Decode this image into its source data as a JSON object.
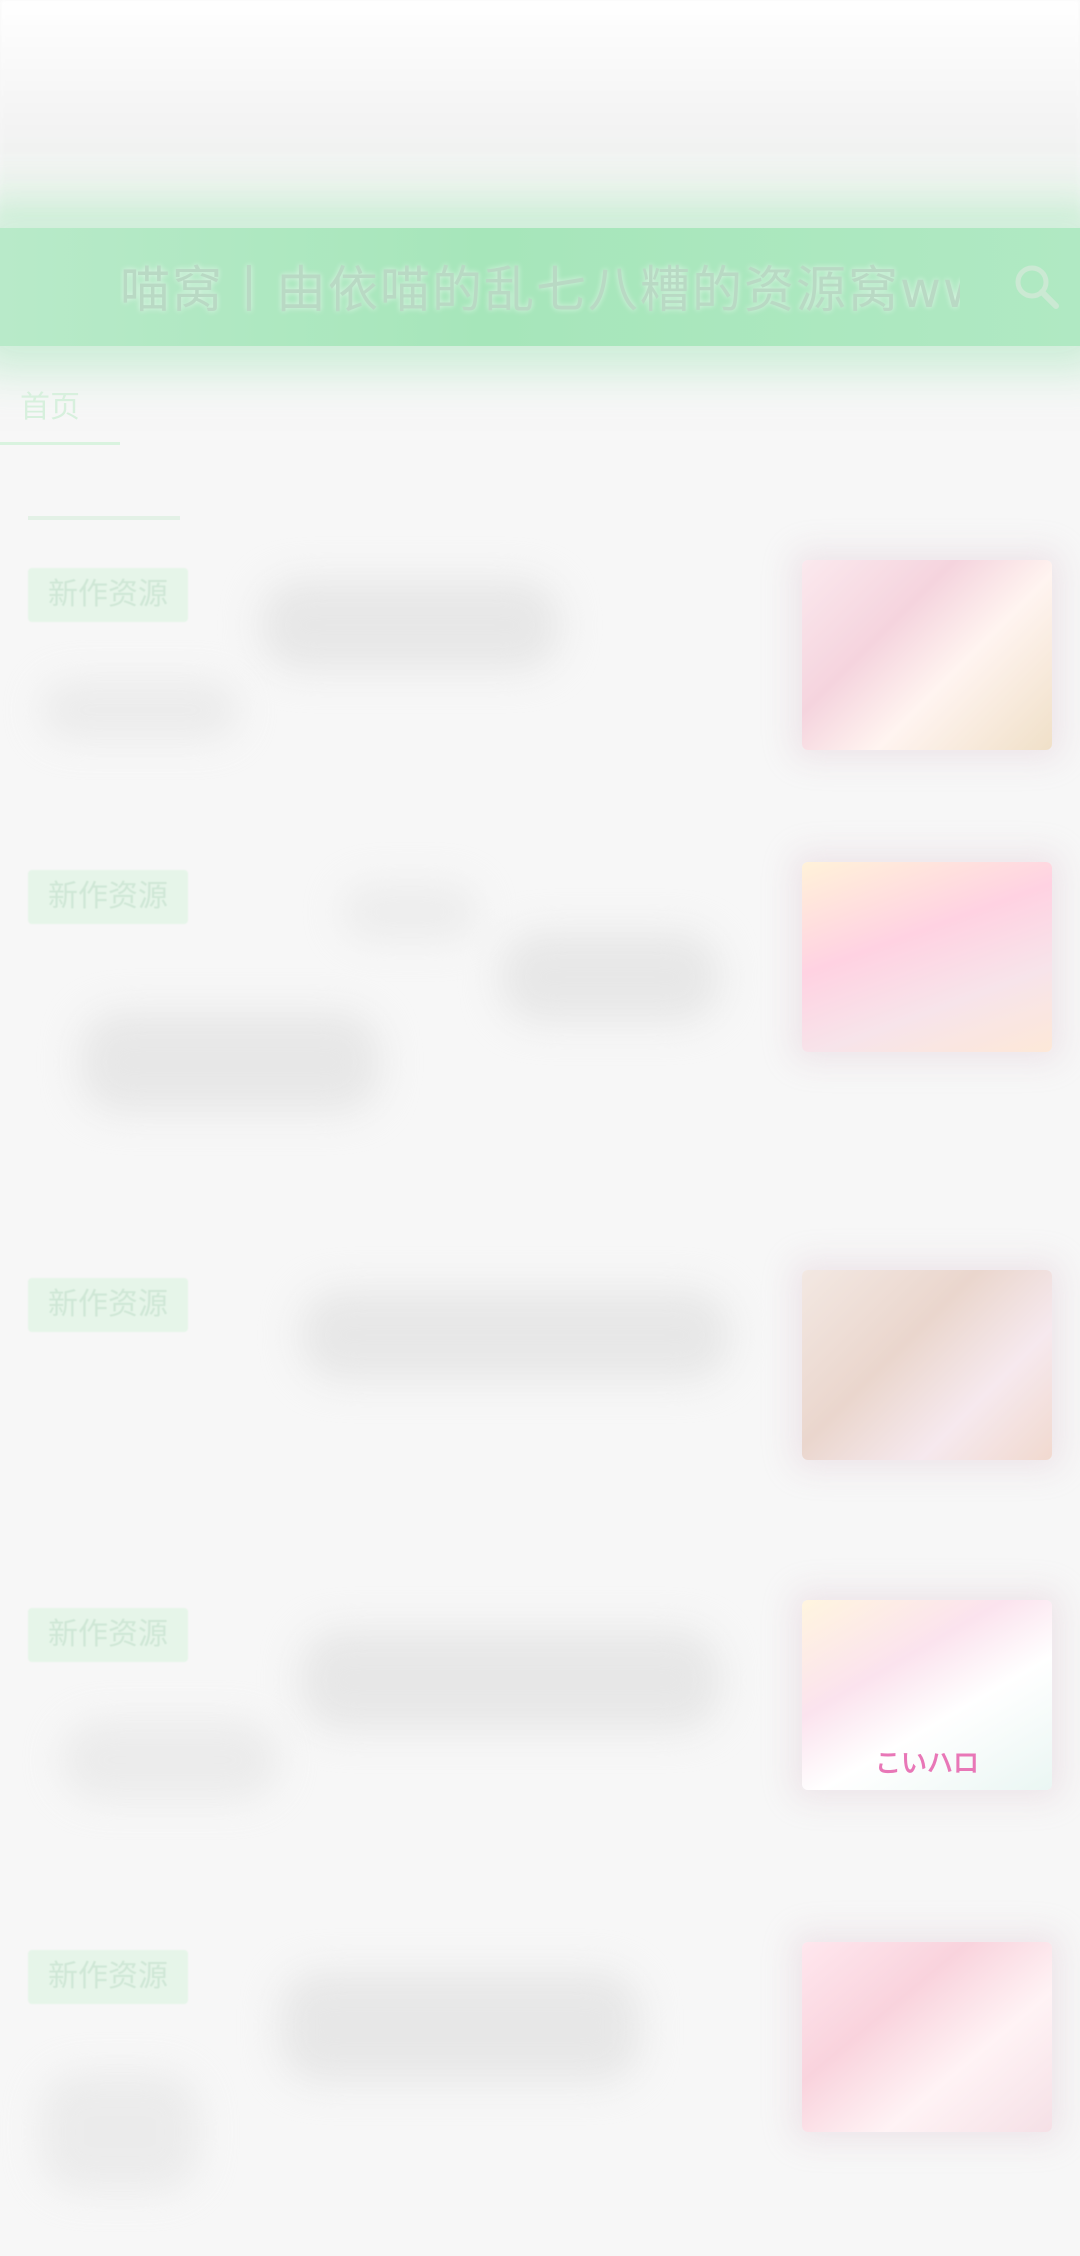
{
  "header": {
    "title": "喵窝丨由依喵的乱七八糟的资源窝www",
    "search_icon": "search-icon",
    "accent": "#a6e6ba"
  },
  "nav": {
    "home_label": "首页"
  },
  "posts": [
    {
      "badge": "新作资源",
      "thumb_caption": ""
    },
    {
      "badge": "新作资源",
      "thumb_caption": ""
    },
    {
      "badge": "新作资源",
      "thumb_caption": ""
    },
    {
      "badge": "新作资源",
      "thumb_caption": "こいハロ"
    },
    {
      "badge": "新作资源",
      "thumb_caption": ""
    }
  ]
}
